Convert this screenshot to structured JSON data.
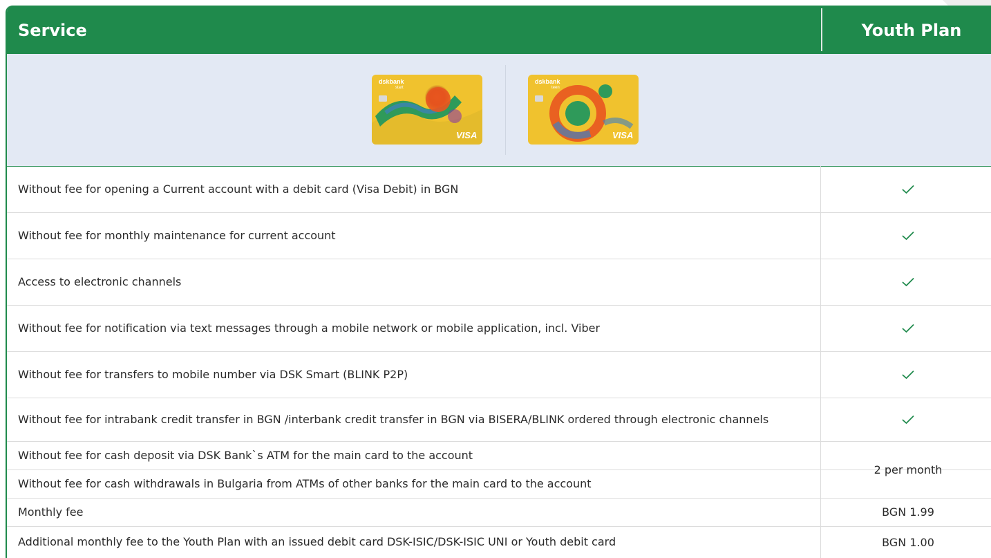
{
  "header": {
    "service": "Service",
    "plan": "Youth Plan"
  },
  "cards": [
    {
      "name": "dsk-start-card",
      "brand": "dskbank",
      "subtitle": "start",
      "network": "VISA",
      "accent": "#f0c22e"
    },
    {
      "name": "dsk-teen-card",
      "brand": "dskbank",
      "subtitle": "teen",
      "network": "VISA",
      "accent": "#f0c22e"
    }
  ],
  "rows": [
    {
      "label": "Without fee for opening a Current account with a debit card (Visa Debit) in BGN",
      "value": "check"
    },
    {
      "label": "Without fee for monthly maintenance for current account",
      "value": "check"
    },
    {
      "label": "Access to electronic channels",
      "value": "check"
    },
    {
      "label": "Without fee for notification via text messages through a mobile network or mobile application, incl. Viber",
      "value": "check"
    },
    {
      "label": "Without fee for transfers to mobile number via DSK Smart (BLINK P2P)",
      "value": "check"
    },
    {
      "label": "Without fee for intrabank credit transfer in BGN /interbank credit transfer in BGN via BISERA/BLINK ordered through electronic channels",
      "value": "check"
    },
    {
      "label": "Without fee for cash deposit via DSK Bank`s ATM  for the main card to the account",
      "value": ""
    },
    {
      "label": "Without  fee for cash withdrawals in Bulgaria from ATMs of other banks for the main card to the account",
      "value": ""
    },
    {
      "label": "Monthly fee",
      "value": "BGN 1.99"
    },
    {
      "label": "Additional monthly fee to the Youth Plan with an issued debit card  DSK-ISIC/DSK-ISIC UNI or Youth debit card",
      "value": "BGN 1.00"
    }
  ],
  "merged_value": "2 per month",
  "colors": {
    "brand_green": "#1f8a4c",
    "cards_band": "#e3e9f4",
    "check": "#1f8a4c"
  }
}
